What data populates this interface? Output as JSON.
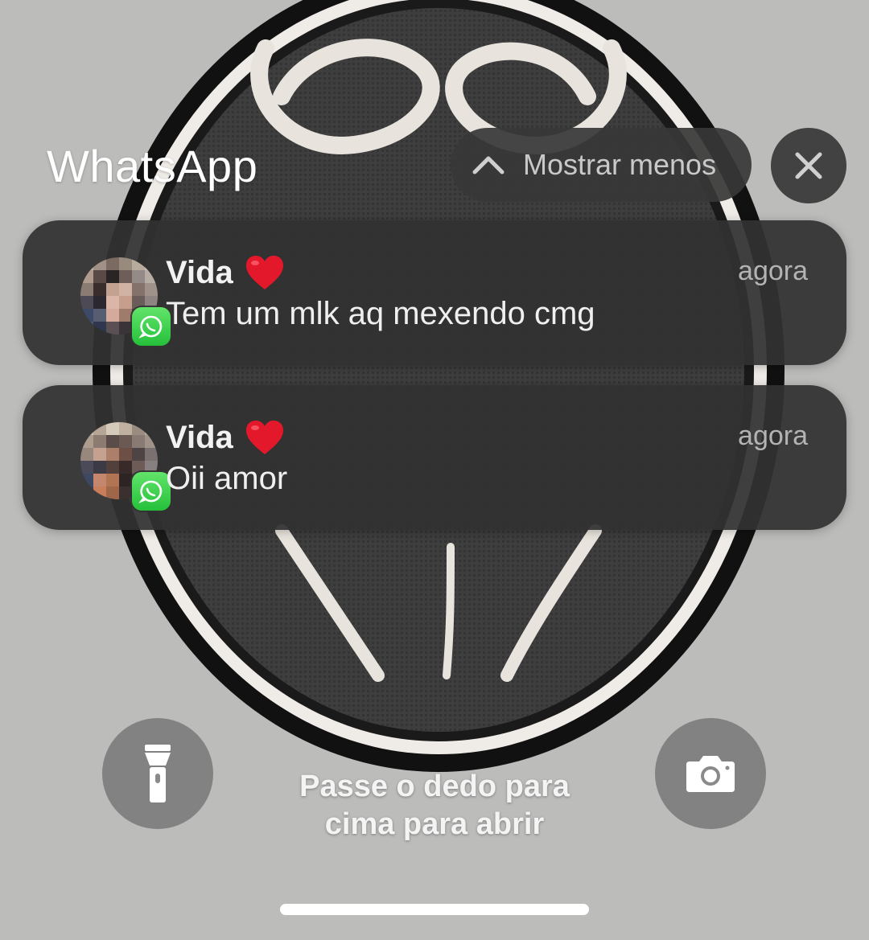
{
  "group": {
    "app_title": "WhatsApp",
    "show_less_label": "Mostrar menos",
    "close_icon": "close-icon"
  },
  "notifications": [
    {
      "sender": "Vida",
      "emoji": "heart",
      "time": "agora",
      "message": "Tem um mlk aq mexendo cmg",
      "app_icon": "whatsapp-icon"
    },
    {
      "sender": "Vida",
      "emoji": "heart",
      "time": "agora",
      "message": "Oii amor",
      "app_icon": "whatsapp-icon"
    }
  ],
  "lockscreen": {
    "hint_line1": "Passe o dedo para",
    "hint_line2": "cima para abrir",
    "left_button_icon": "flashlight-icon",
    "right_button_icon": "camera-icon"
  },
  "colors": {
    "notification_bg": "#323232",
    "whatsapp_green": "#25c03a",
    "heart_red": "#e3192b"
  }
}
